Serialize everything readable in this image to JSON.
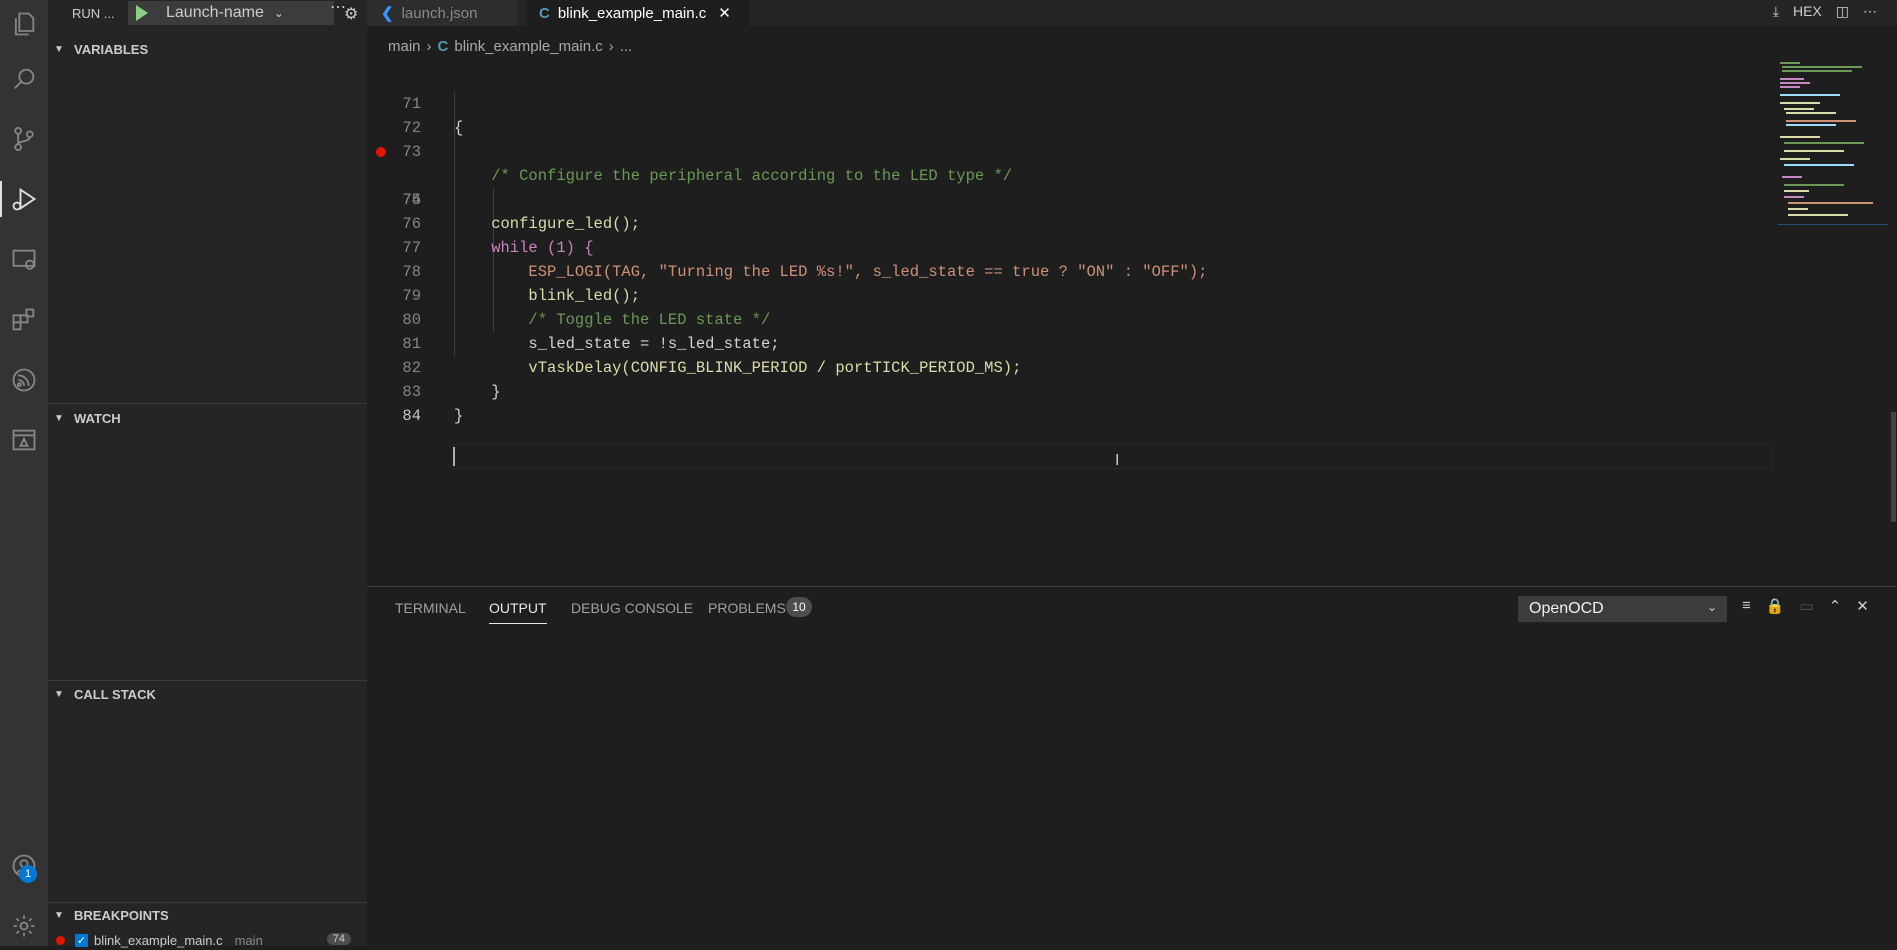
{
  "activity_bar": {
    "icons": [
      "explorer-icon",
      "search-icon",
      "source-control-icon",
      "run-debug-icon",
      "remote-explorer-icon",
      "extensions-icon",
      "esp-idf-icon",
      "testing-icon",
      "account-icon",
      "manage-gear-icon"
    ],
    "account_badge": "1"
  },
  "sidebar": {
    "run_title": "RUN ...",
    "launch_config": "Launch-name",
    "sections": {
      "variables": "VARIABLES",
      "watch": "WATCH",
      "call_stack": "CALL STACK",
      "breakpoints": "BREAKPOINTS"
    },
    "breakpoint_item": {
      "file": "blink_example_main.c",
      "dir": "main",
      "line": "74"
    }
  },
  "tabs": [
    {
      "label": "launch.json",
      "icon": "vscode-icon",
      "active": false
    },
    {
      "label": "blink_example_main.c",
      "icon": "c-file-icon",
      "active": true
    }
  ],
  "editor_top_right": {
    "hex_label": "HEX"
  },
  "breadcrumb": {
    "folder": "main",
    "file": "blink_example_main.c",
    "more": "..."
  },
  "code": {
    "lines": [
      {
        "n": "71",
        "text": "{"
      },
      {
        "n": "72",
        "text": ""
      },
      {
        "n": "73",
        "text": "    /* Configure the peripheral according to the LED type */"
      },
      {
        "n": "74",
        "text": "    configure_led();",
        "breakpoint": true
      },
      {
        "n": "75",
        "text": ""
      },
      {
        "n": "76",
        "text": "    while (1) {"
      },
      {
        "n": "77",
        "text": "        ESP_LOGI(TAG, \"Turning the LED %s!\", s_led_state == true ? \"ON\" : \"OFF\");"
      },
      {
        "n": "78",
        "text": "        blink_led();"
      },
      {
        "n": "79",
        "text": "        /* Toggle the LED state */"
      },
      {
        "n": "80",
        "text": "        s_led_state = !s_led_state;"
      },
      {
        "n": "81",
        "text": "        vTaskDelay(CONFIG_BLINK_PERIOD / portTICK_PERIOD_MS);"
      },
      {
        "n": "82",
        "text": "    }"
      },
      {
        "n": "83",
        "text": "}"
      },
      {
        "n": "84",
        "text": ""
      }
    ]
  },
  "panel": {
    "tabs": [
      "TERMINAL",
      "OUTPUT",
      "DEBUG CONSOLE",
      "PROBLEMS"
    ],
    "active_tab": "OUTPUT",
    "problems_count": "10",
    "output_channel": "OpenOCD"
  },
  "colors": {
    "breakpoint": "#e51400",
    "accent": "#0078d4",
    "play": "#89d185"
  }
}
